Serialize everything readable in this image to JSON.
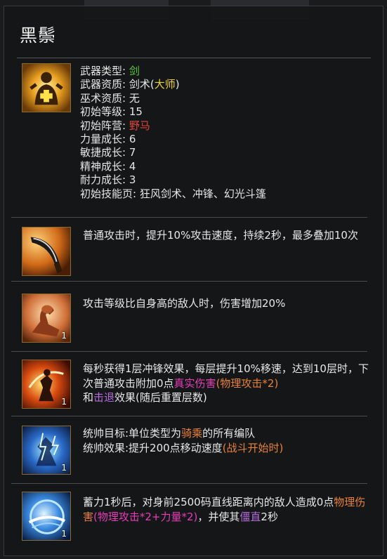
{
  "hero_name": "黑鬃",
  "info": {
    "rows": [
      {
        "label": "武器类型",
        "value": "剑",
        "color": "#58c83c"
      },
      {
        "label": "武器资质",
        "value_prefix": "剑术(",
        "value_highlight": "大师",
        "value_suffix": ")"
      },
      {
        "label": "巫术资质",
        "value": "无"
      },
      {
        "label": "初始等级",
        "value": "15"
      },
      {
        "label": "初始阵营",
        "value": "野马",
        "color": "#e0453a"
      },
      {
        "label": "力量成长",
        "value": "6"
      },
      {
        "label": "敏捷成长",
        "value": "7"
      },
      {
        "label": "精神成长",
        "value": "4"
      },
      {
        "label": "耐力成长",
        "value": "3"
      },
      {
        "label": "初始技能页",
        "value": "狂风剑术、冲锋、幻光斗篷"
      }
    ],
    "colon": ": "
  },
  "skills": [
    {
      "icon": "curved-blade-icon",
      "level": "",
      "text": "普通攻击时，提升10%攻击速度，持续2秒，最多叠加10次"
    },
    {
      "icon": "flexed-arm-icon",
      "level": "1",
      "text": "攻击等级比自身高的敌人时，伤害增加20%"
    },
    {
      "icon": "charging-warrior-icon",
      "level": "1",
      "parts": [
        "每秒获得1层冲锋效果，每层提升10%移速，达到10层时，下次普通攻击附加0点",
        "真实伤害",
        "(物理攻击*2)",
        "和",
        "击退",
        "效果(随后重置层数)"
      ]
    },
    {
      "icon": "lightning-rider-icon",
      "level": "1",
      "line1_prefix": "统帅目标:单位类型为",
      "line1_highlight": "骑乘",
      "line1_suffix": "的所有编队",
      "line2_prefix": "统帅效果:提升200点移动速度",
      "line2_highlight": "(战斗开始时)"
    },
    {
      "icon": "blue-orb-slash-icon",
      "level": "1",
      "parts": [
        "蓄力1秒后，对身前2500码直线距离内的敌人造成0点",
        "物理伤害",
        "(物理攻击*2+力量*2)",
        "，并使其",
        "僵直",
        "2秒"
      ]
    }
  ],
  "colors": {
    "green": "#58c83c",
    "yellow": "#f0d23a",
    "red": "#e0453a",
    "magenta": "#e83cb8",
    "orange": "#e8823a",
    "purple": "#b66ce0",
    "teal": "#38c8c8"
  }
}
